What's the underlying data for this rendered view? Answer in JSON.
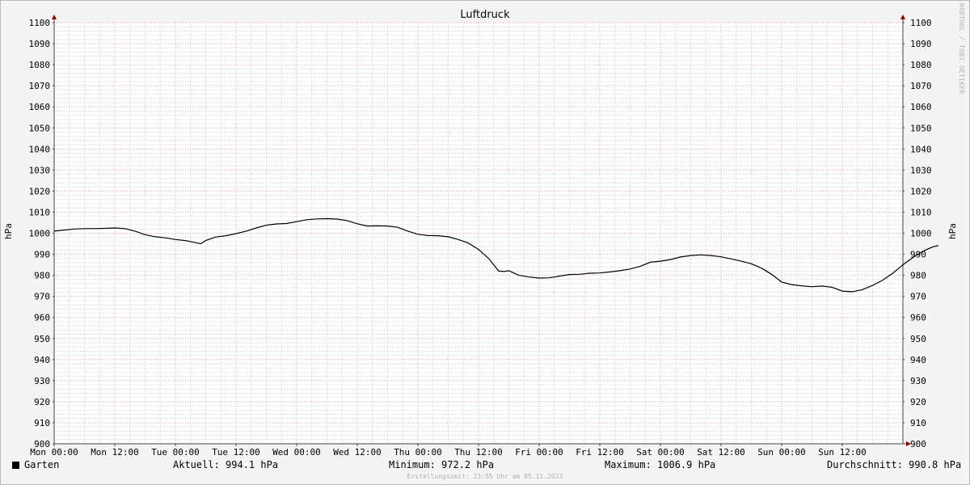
{
  "chart_data": {
    "type": "line",
    "title": "Luftdruck",
    "ylabel": "hPa",
    "y2label": "hPa",
    "ylim": [
      900,
      1100
    ],
    "ytick_step": 10,
    "x_ticks": [
      "Mon 00:00",
      "Mon 12:00",
      "Tue 00:00",
      "Tue 12:00",
      "Wed 00:00",
      "Wed 12:00",
      "Thu 00:00",
      "Thu 12:00",
      "Fri 00:00",
      "Fri 12:00",
      "Sat 00:00",
      "Sat 12:00",
      "Sun 00:00",
      "Sun 12:00"
    ],
    "x_unit": "hours since Mon 00:00",
    "xlim": [
      0,
      168
    ],
    "grid": true,
    "series": [
      {
        "name": "Garten",
        "color": "#000000",
        "points": [
          [
            0,
            1001.0
          ],
          [
            2,
            1001.5
          ],
          [
            4,
            1002.0
          ],
          [
            6,
            1002.2
          ],
          [
            8,
            1002.2
          ],
          [
            10,
            1002.3
          ],
          [
            12,
            1002.5
          ],
          [
            14,
            1002.2
          ],
          [
            16,
            1001.0
          ],
          [
            18,
            999.3
          ],
          [
            20,
            998.3
          ],
          [
            22,
            997.8
          ],
          [
            24,
            997.0
          ],
          [
            26,
            996.5
          ],
          [
            28,
            995.5
          ],
          [
            29,
            995.0
          ],
          [
            30,
            996.5
          ],
          [
            32,
            998.2
          ],
          [
            34,
            998.8
          ],
          [
            36,
            999.8
          ],
          [
            38,
            1001.0
          ],
          [
            40,
            1002.5
          ],
          [
            42,
            1003.8
          ],
          [
            44,
            1004.4
          ],
          [
            46,
            1004.6
          ],
          [
            48,
            1005.5
          ],
          [
            50,
            1006.4
          ],
          [
            52,
            1006.8
          ],
          [
            54,
            1006.9
          ],
          [
            56,
            1006.7
          ],
          [
            58,
            1006.0
          ],
          [
            60,
            1004.5
          ],
          [
            62,
            1003.4
          ],
          [
            64,
            1003.5
          ],
          [
            66,
            1003.4
          ],
          [
            68,
            1002.8
          ],
          [
            70,
            1001.0
          ],
          [
            72,
            999.5
          ],
          [
            74,
            998.9
          ],
          [
            76,
            998.8
          ],
          [
            78,
            998.3
          ],
          [
            80,
            997.0
          ],
          [
            82,
            995.3
          ],
          [
            84,
            992.3
          ],
          [
            86,
            988.0
          ],
          [
            87,
            985.0
          ],
          [
            88,
            982.0
          ],
          [
            89,
            981.8
          ],
          [
            90,
            982.2
          ],
          [
            92,
            980.0
          ],
          [
            94,
            979.2
          ],
          [
            96,
            978.7
          ],
          [
            98,
            978.8
          ],
          [
            100,
            979.6
          ],
          [
            102,
            980.4
          ],
          [
            104,
            980.5
          ],
          [
            106,
            981.0
          ],
          [
            108,
            981.1
          ],
          [
            110,
            981.6
          ],
          [
            112,
            982.2
          ],
          [
            114,
            983.0
          ],
          [
            116,
            984.3
          ],
          [
            118,
            986.2
          ],
          [
            120,
            986.7
          ],
          [
            122,
            987.5
          ],
          [
            124,
            988.7
          ],
          [
            126,
            989.4
          ],
          [
            128,
            989.7
          ],
          [
            130,
            989.4
          ],
          [
            132,
            988.8
          ],
          [
            134,
            987.8
          ],
          [
            136,
            986.7
          ],
          [
            138,
            985.5
          ],
          [
            140,
            983.4
          ],
          [
            142,
            980.5
          ],
          [
            144,
            976.8
          ],
          [
            146,
            975.6
          ],
          [
            148,
            975.0
          ],
          [
            150,
            974.6
          ],
          [
            152,
            974.9
          ],
          [
            154,
            974.3
          ],
          [
            156,
            972.5
          ],
          [
            158,
            972.2
          ],
          [
            160,
            973.2
          ],
          [
            162,
            975.2
          ],
          [
            164,
            977.7
          ],
          [
            166,
            981.0
          ],
          [
            168,
            985.0
          ],
          [
            170,
            988.5
          ],
          [
            172,
            991.5
          ],
          [
            174,
            993.6
          ],
          [
            175,
            994.1
          ]
        ]
      }
    ]
  },
  "watermark": "RRDTOOL / TOBI OETIKER",
  "legend": {
    "series_name": "Garten",
    "current": "Aktuell: 994.1 hPa",
    "minimum": "Minimum: 972.2 hPa",
    "maximum": "Maximum: 1006.9 hPa",
    "average": "Durchschnitt: 990.8 hPa"
  },
  "footer": "Erstellungszeit: 23:55 Uhr am 05.11.2023",
  "colors": {
    "background": "#f4f4f4",
    "plot_background": "#ffffff",
    "minor_grid": "#d9d9d9",
    "major_grid": "#e8a0a0",
    "axis_arrow": "#8b0000",
    "line": "#000000"
  }
}
